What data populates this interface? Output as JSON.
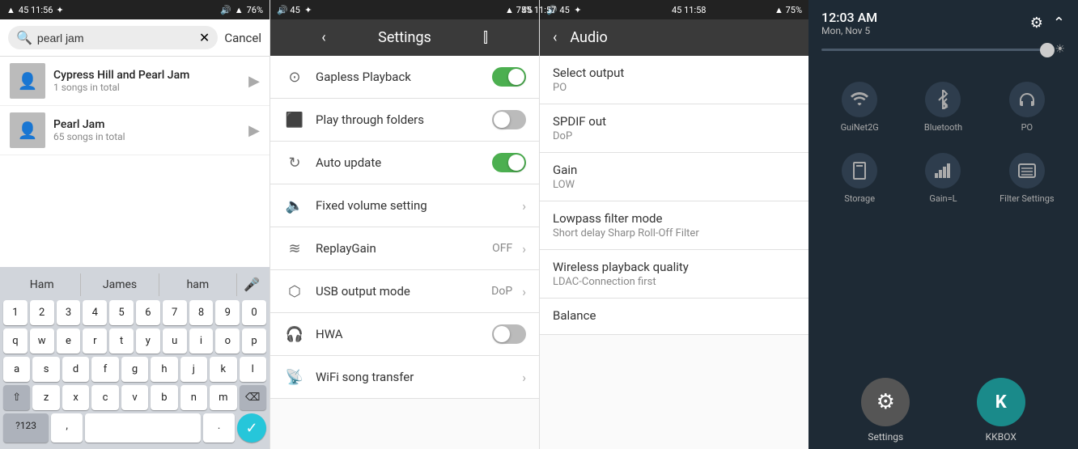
{
  "panel1": {
    "status": {
      "left": "45  11:56",
      "right": "76%"
    },
    "search": {
      "placeholder": "pearl jam",
      "cancel_label": "Cancel",
      "clear_icon": "✕"
    },
    "songs": [
      {
        "title": "Cypress Hill and Pearl Jam",
        "subtitle": "1 songs in total"
      },
      {
        "title": "Pearl Jam",
        "subtitle": "65 songs in total"
      }
    ],
    "suggestions": [
      "Ham",
      "James",
      "ham"
    ],
    "keyboard_rows": [
      [
        "q",
        "w",
        "e",
        "r",
        "t",
        "y",
        "u",
        "i",
        "o",
        "p"
      ],
      [
        "a",
        "s",
        "d",
        "f",
        "g",
        "h",
        "j",
        "k",
        "l"
      ],
      [
        "z",
        "x",
        "c",
        "v",
        "b",
        "n",
        "m"
      ]
    ],
    "special_keys": {
      "shift": "⇧",
      "delete": "⌫",
      "symbols": "?123",
      "comma": ",",
      "space": "",
      "period": ".",
      "enter": "✓"
    }
  },
  "panel2": {
    "status": {
      "left": "45  11:57",
      "right": "75%"
    },
    "title": "Settings",
    "items": [
      {
        "label": "Gapless Playback",
        "toggle": true,
        "icon": "▶"
      },
      {
        "label": "Play through folders",
        "toggle": false,
        "icon": "📁"
      },
      {
        "label": "Auto update",
        "toggle": true,
        "icon": "🔄"
      },
      {
        "label": "Fixed volume setting",
        "toggle": null,
        "icon": "🔈",
        "hasChevron": true
      },
      {
        "label": "ReplayGain",
        "value": "OFF",
        "icon": "📶",
        "hasChevron": true
      },
      {
        "label": "USB output mode",
        "value": "DoP",
        "icon": "🔌",
        "hasChevron": true
      },
      {
        "label": "HWA",
        "toggle": false,
        "icon": "🎧"
      },
      {
        "label": "WiFi song transfer",
        "toggle": null,
        "icon": "📡",
        "hasChevron": true
      }
    ]
  },
  "panel3": {
    "status": {
      "left": "45  11:58",
      "right": "75%"
    },
    "title": "Audio",
    "items": [
      {
        "title": "Select output",
        "sub": "PO"
      },
      {
        "title": "SPDIF out",
        "sub": "DoP"
      },
      {
        "title": "Gain",
        "sub": "LOW"
      },
      {
        "title": "Lowpass filter mode",
        "sub": "Short delay Sharp Roll-Off Filter"
      },
      {
        "title": "Wireless playback quality",
        "sub": "LDAC-Connection first"
      },
      {
        "title": "Balance",
        "sub": ""
      }
    ]
  },
  "panel4": {
    "time": "12:03 AM",
    "date": "Mon, Nov 5",
    "gear_icon": "⚙",
    "collapse_icon": "⌃",
    "brightness_icon": "☀",
    "tiles": [
      {
        "label": "GuiNet2G",
        "icon": "📶",
        "active": false
      },
      {
        "label": "Bluetooth",
        "icon": "⚡",
        "active": false
      },
      {
        "label": "PO",
        "icon": "🎧",
        "active": false
      },
      {
        "label": "Storage",
        "icon": "💾",
        "active": false
      },
      {
        "label": "Gain=L",
        "icon": "📊",
        "active": false
      },
      {
        "label": "Filter Settings",
        "icon": "📺",
        "active": false
      }
    ],
    "apps": [
      {
        "label": "Settings",
        "icon": "⚙",
        "type": "settings"
      },
      {
        "label": "KKBOX",
        "icon": "K",
        "type": "kkbox"
      }
    ]
  }
}
